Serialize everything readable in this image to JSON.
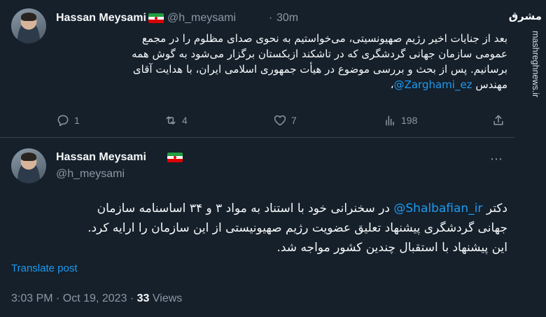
{
  "tweet1": {
    "author_name": "Hassan Meysami",
    "handle": "@h_meysami",
    "separator": "·",
    "time": "30m",
    "lines": [
      "بعد از جنایات اخیر رژیم صهیونسیتی، می‌خواستیم به نحوی صدای مظلوم را در مجمع",
      "عمومی سازمان جهانی گردشگری که در تاشکند ازبکستان برگزار می‌شود به گوش همه",
      "برسانیم. پس از بحث و بررسی موضوع در هیأت جمهوری اسلامی ایران، با هدایت آقای"
    ],
    "last_line_prefix": "مهندس ",
    "mention": "@Zarghami_ez",
    "last_line_suffix": "،",
    "actions": {
      "reply_count": "1",
      "retweet_count": "4",
      "like_count": "7",
      "views_count": "198"
    }
  },
  "tweet2": {
    "author_name": "Hassan Meysami",
    "handle": "@h_meysami",
    "more_icon": "⋯",
    "line1_prefix": "دکتر ",
    "mention": "@Shalbafian_ir",
    "line1_suffix": " در سخنرانی خود با استناد به مواد ۳ و ۳۴ اساسنامه سازمان",
    "line2": "جهانی گردشگری پیشنهاد تعلیق عضویت رژیم صهیونیستی از این سازمان را ارایه کرد.",
    "line3": "این پیشنهاد با استقبال چندین کشور مواجه شد.",
    "translate": "Translate post",
    "timestamp": "3:03 PM · Oct 19, 2023 · ",
    "views_count": "33",
    "views_label": " Views"
  },
  "watermark": {
    "logo_text": "مشرق",
    "site": "mashreghnews.ir"
  },
  "icons": {
    "reply": "reply-icon",
    "retweet": "retweet-icon",
    "like": "heart-icon",
    "views": "views-icon",
    "share": "share-icon"
  },
  "colors": {
    "background": "#15202b",
    "accent": "#1d9bf0",
    "muted": "#8b98a5",
    "text": "#f7f9f9"
  }
}
